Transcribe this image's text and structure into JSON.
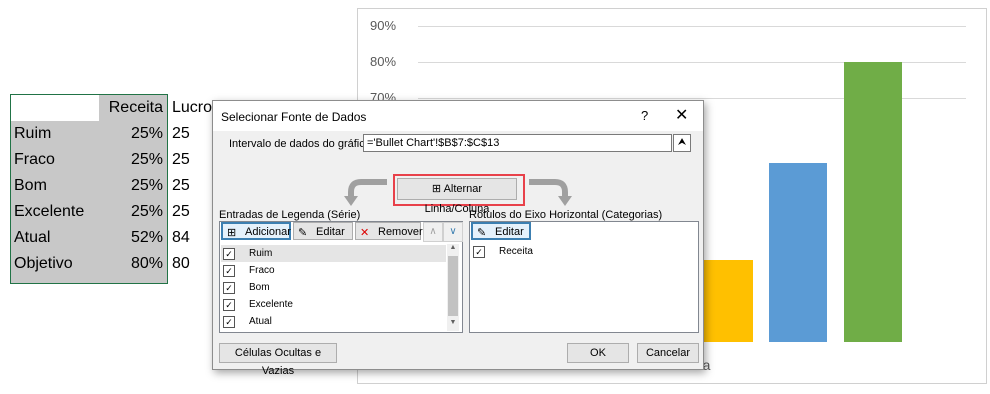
{
  "spreadsheet": {
    "header": "Receita",
    "rows": [
      {
        "label": "Ruim",
        "value": "25%"
      },
      {
        "label": "Fraco",
        "value": "25%"
      },
      {
        "label": "Bom",
        "value": "25%"
      },
      {
        "label": "Excelente",
        "value": "25%"
      },
      {
        "label": "Atual",
        "value": "52%"
      },
      {
        "label": "Objetivo",
        "value": "80%"
      }
    ],
    "next_column": {
      "header": "Lucro",
      "values": [
        "25",
        "25",
        "25",
        "25",
        "84",
        "80"
      ]
    }
  },
  "chart_data": {
    "type": "bar",
    "yticks": [
      "90%",
      "80%",
      "70%"
    ],
    "xlabel": "Receita",
    "ylim": [
      0,
      0.9
    ],
    "visible_bars": [
      {
        "value": 0.25,
        "color": "#ffc000"
      },
      {
        "value": 0.52,
        "color": "#5b9bd5"
      },
      {
        "value": 0.8,
        "color": "#70ad47"
      }
    ]
  },
  "dialog": {
    "title": "Selecionar Fonte de Dados",
    "help": "?",
    "close": "✕",
    "range_label": "Intervalo de dados do gráfico:",
    "range_value": "='Bullet Chart'!$B$7:$C$13",
    "switch_label": "Alternar Linha/Coluna",
    "series_label": "Entradas de Legenda (Série)",
    "categories_label": "Rótulos do Eixo Horizontal (Categorias)",
    "add": "Adicionar",
    "edit": "Editar",
    "remove": "Remover",
    "edit_cat": "Editar",
    "series": [
      {
        "name": "Ruim",
        "checked": true
      },
      {
        "name": "Fraco",
        "checked": true
      },
      {
        "name": "Bom",
        "checked": true
      },
      {
        "name": "Excelente",
        "checked": true
      },
      {
        "name": "Atual",
        "checked": true
      }
    ],
    "categories": [
      {
        "name": "Receita",
        "checked": true
      }
    ],
    "hidden_cells": "Células Ocultas e Vazias",
    "ok": "OK",
    "cancel": "Cancelar"
  }
}
